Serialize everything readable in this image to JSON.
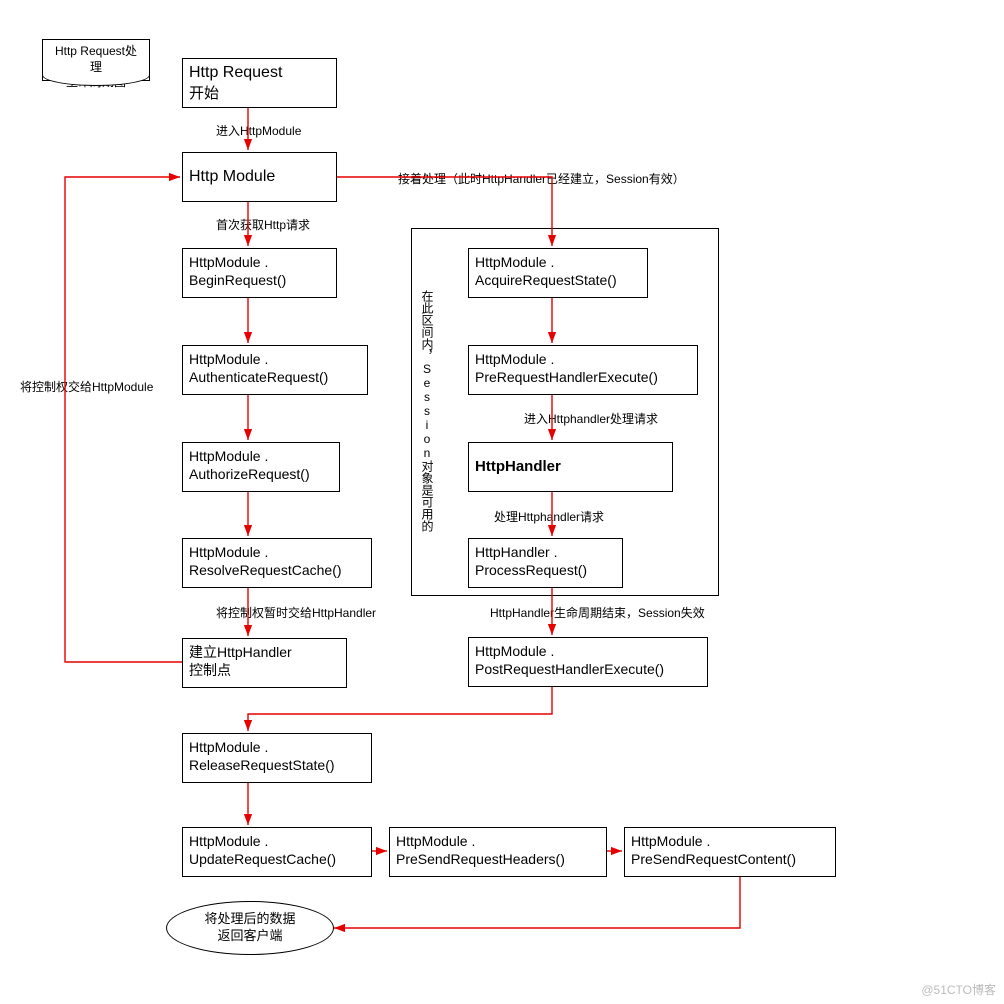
{
  "note_title": "Http Request处理\n生命周期图",
  "boxes": {
    "start": {
      "l1": "Http Request",
      "l2": "开始"
    },
    "module": {
      "l1": "Http Module"
    },
    "begin": {
      "l1": "HttpModule .",
      "l2": "BeginRequest()"
    },
    "auth": {
      "l1": "HttpModule .",
      "l2": "AuthenticateRequest()"
    },
    "authorize": {
      "l1": "HttpModule .",
      "l2": "AuthorizeRequest()"
    },
    "resolve": {
      "l1": "HttpModule .",
      "l2": "ResolveRequestCache()"
    },
    "establish": {
      "l1": "建立HttpHandler",
      "l2": "控制点"
    },
    "acquire": {
      "l1": "HttpModule .",
      "l2": "AcquireRequestState()"
    },
    "preexec": {
      "l1": "HttpModule .",
      "l2": "PreRequestHandlerExecute()"
    },
    "handler": {
      "l1": "HttpHandler"
    },
    "process": {
      "l1": "HttpHandler .",
      "l2": "ProcessRequest()"
    },
    "postexec": {
      "l1": "HttpModule .",
      "l2": "PostRequestHandlerExecute()"
    },
    "release": {
      "l1": "HttpModule .",
      "l2": "ReleaseRequestState()"
    },
    "update": {
      "l1": "HttpModule .",
      "l2": "UpdateRequestCache()"
    },
    "preheaders": {
      "l1": "HttpModule .",
      "l2": "PreSendRequestHeaders()"
    },
    "precontent": {
      "l1": "HttpModule .",
      "l2": "PreSendRequestContent()"
    }
  },
  "labels": {
    "enter_module": "进入HttpModule",
    "first_get": "首次获取Http请求",
    "left_return": "将控制权交给HttpModule",
    "hand_over": "将控制权暂时交给HttpHandler",
    "continue": "接着处理（此时HttpHandler已经建立，Session有效）",
    "enter_handler": "进入Httphandler处理请求",
    "process_handler": "处理Httphandler请求",
    "handler_end": "HttpHandler生命周期结束，Session失效",
    "vnote": "在此区间内，Session对象是可用的"
  },
  "ellipse": {
    "l1": "将处理后的数据",
    "l2": "返回客户端"
  },
  "watermark": "@51CTO博客",
  "chart_data": {
    "type": "flowchart",
    "title": "Http Request处理生命周期图",
    "nodes": [
      {
        "id": "start",
        "type": "process",
        "label": "Http Request 开始"
      },
      {
        "id": "module",
        "type": "process",
        "label": "Http Module"
      },
      {
        "id": "begin",
        "type": "process",
        "label": "HttpModule.BeginRequest()"
      },
      {
        "id": "auth",
        "type": "process",
        "label": "HttpModule.AuthenticateRequest()"
      },
      {
        "id": "authorize",
        "type": "process",
        "label": "HttpModule.AuthorizeRequest()"
      },
      {
        "id": "resolve",
        "type": "process",
        "label": "HttpModule.ResolveRequestCache()"
      },
      {
        "id": "establish",
        "type": "process",
        "label": "建立HttpHandler 控制点"
      },
      {
        "id": "acquire",
        "type": "process",
        "label": "HttpModule.AcquireRequestState()"
      },
      {
        "id": "preexec",
        "type": "process",
        "label": "HttpModule.PreRequestHandlerExecute()"
      },
      {
        "id": "handler",
        "type": "process",
        "label": "HttpHandler"
      },
      {
        "id": "process",
        "type": "process",
        "label": "HttpHandler.ProcessRequest()"
      },
      {
        "id": "postexec",
        "type": "process",
        "label": "HttpModule.PostRequestHandlerExecute()"
      },
      {
        "id": "release",
        "type": "process",
        "label": "HttpModule.ReleaseRequestState()"
      },
      {
        "id": "update",
        "type": "process",
        "label": "HttpModule.UpdateRequestCache()"
      },
      {
        "id": "preheaders",
        "type": "process",
        "label": "HttpModule.PreSendRequestHeaders()"
      },
      {
        "id": "precontent",
        "type": "process",
        "label": "HttpModule.PreSendRequestContent()"
      },
      {
        "id": "end",
        "type": "terminator",
        "label": "将处理后的数据返回客户端"
      }
    ],
    "edges": [
      {
        "from": "start",
        "to": "module",
        "label": "进入HttpModule"
      },
      {
        "from": "module",
        "to": "begin",
        "label": "首次获取Http请求"
      },
      {
        "from": "begin",
        "to": "auth"
      },
      {
        "from": "auth",
        "to": "authorize"
      },
      {
        "from": "authorize",
        "to": "resolve"
      },
      {
        "from": "resolve",
        "to": "establish",
        "label": "将控制权暂时交给HttpHandler"
      },
      {
        "from": "establish",
        "to": "module",
        "label": "将控制权交给HttpModule"
      },
      {
        "from": "module",
        "to": "acquire",
        "label": "接着处理（此时HttpHandler已经建立，Session有效）"
      },
      {
        "from": "acquire",
        "to": "preexec"
      },
      {
        "from": "preexec",
        "to": "handler",
        "label": "进入Httphandler处理请求"
      },
      {
        "from": "handler",
        "to": "process",
        "label": "处理Httphandler请求"
      },
      {
        "from": "process",
        "to": "postexec",
        "label": "HttpHandler生命周期结束，Session失效"
      },
      {
        "from": "postexec",
        "to": "release"
      },
      {
        "from": "release",
        "to": "update"
      },
      {
        "from": "update",
        "to": "preheaders"
      },
      {
        "from": "preheaders",
        "to": "precontent"
      },
      {
        "from": "precontent",
        "to": "end"
      }
    ],
    "groups": [
      {
        "label": "在此区间内，Session对象是可用的",
        "members": [
          "acquire",
          "preexec",
          "handler",
          "process"
        ]
      }
    ]
  }
}
